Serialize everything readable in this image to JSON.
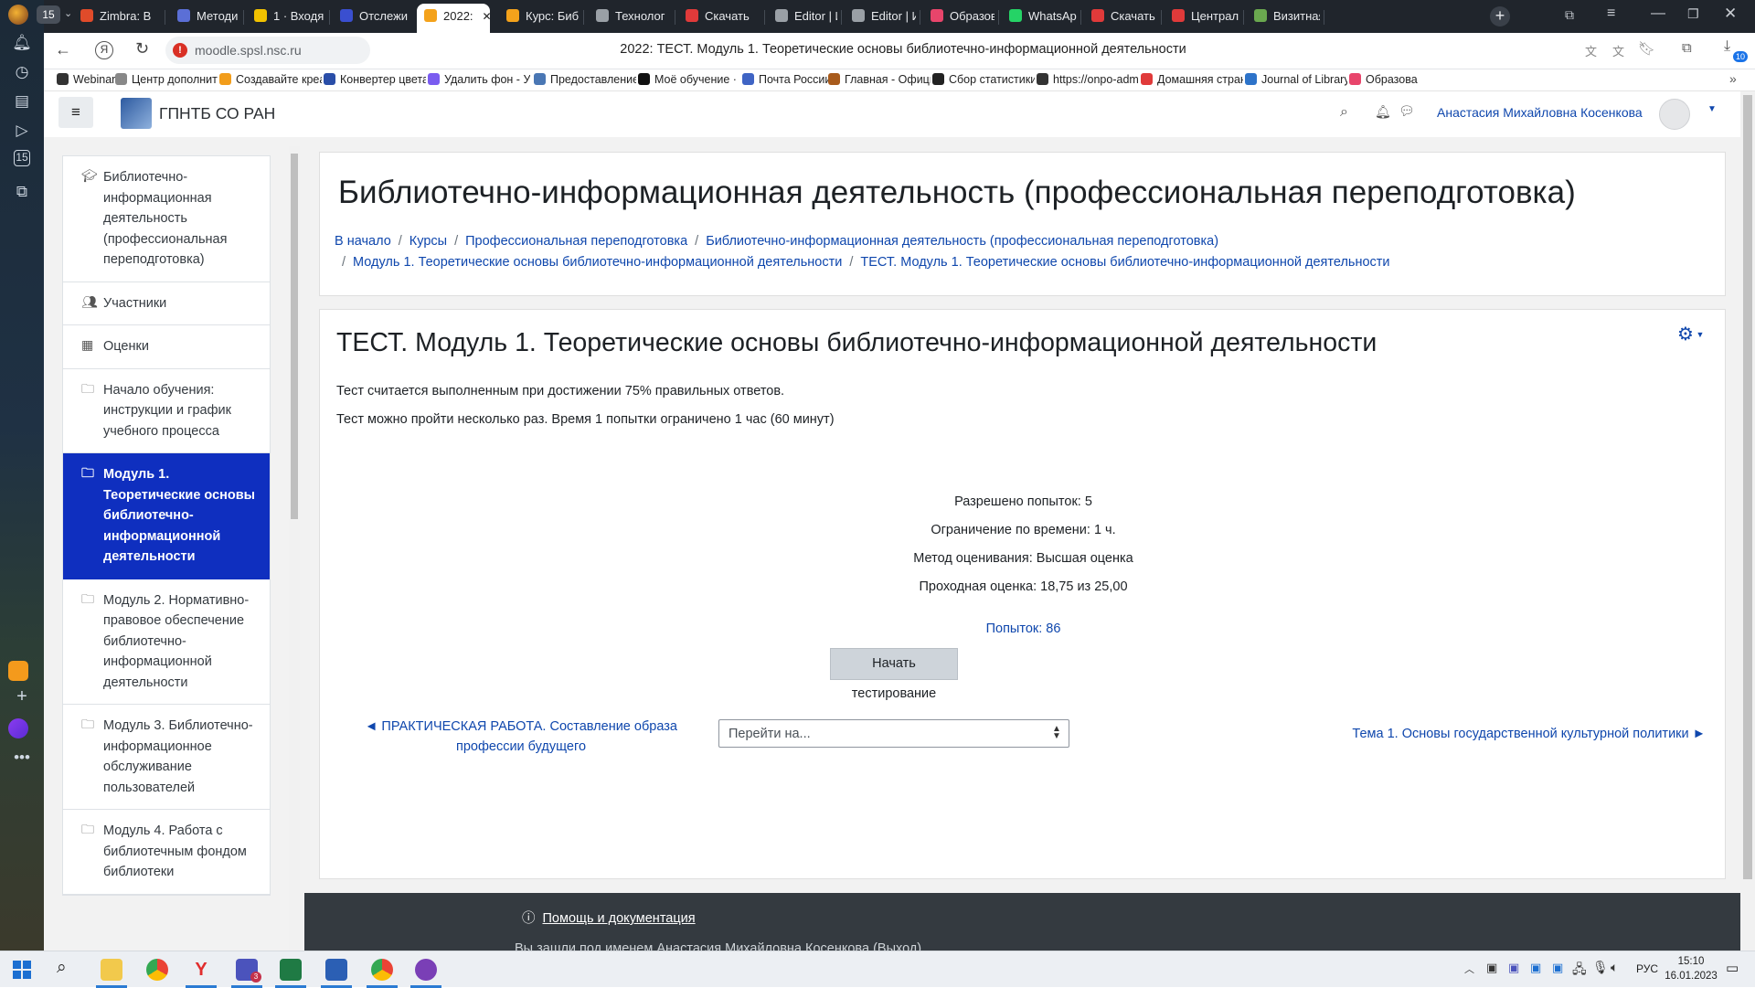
{
  "browser": {
    "tab_count": "15",
    "tabs": [
      {
        "label": "Zimbra: В",
        "color": "#e04b2a"
      },
      {
        "label": "Методи",
        "color": "#5b6fd6"
      },
      {
        "label": "1 · Входя",
        "color": "#f2c200"
      },
      {
        "label": "Отслежи",
        "color": "#3a4fd0"
      },
      {
        "label": "2022:",
        "color": "#f4a21b"
      },
      {
        "label": "Курс: Биб",
        "color": "#f4a21b"
      },
      {
        "label": "Технолог",
        "color": "#9aa0a6"
      },
      {
        "label": "Скачать",
        "color": "#e03a3a"
      },
      {
        "label": "Editor | И",
        "color": "#9aa0a6"
      },
      {
        "label": "Editor | И",
        "color": "#9aa0a6"
      },
      {
        "label": "Образов",
        "color": "#e8456b"
      },
      {
        "label": "WhatsAp",
        "color": "#25d366"
      },
      {
        "label": "Скачать",
        "color": "#e03a3a"
      },
      {
        "label": "Централ",
        "color": "#e03a3a"
      },
      {
        "label": "Визитная",
        "color": "#6aa84f"
      }
    ],
    "url": "moodle.spsl.nsc.ru",
    "page_title": "2022: ТЕСТ. Модуль 1. Теоретические основы библиотечно-информационной деятельности",
    "download_badge": "10",
    "bookmarks": [
      "Webinar",
      "Центр дополните",
      "Создавайте креат",
      "Конвертер цвета",
      "Удалить фон - Убр",
      "Предоставление с",
      "Моё обучение · М",
      "Почта России",
      "Главная - Официа",
      "Сбор статистики г",
      "https://onpo-adm",
      "Домашняя страни",
      "Journal of Library",
      "Образова"
    ]
  },
  "site": {
    "name": "ГПНТБ СО РАН",
    "user_name": "Анастасия Михайловна Косенкова"
  },
  "drawer": {
    "items": [
      {
        "icon": "graduation-cap-icon",
        "label": "Библиотечно-информационная деятельность (профессиональная переподготовка)",
        "active": false
      },
      {
        "icon": "users-icon",
        "label": "Участники",
        "active": false
      },
      {
        "icon": "table-icon",
        "label": "Оценки",
        "active": false
      },
      {
        "icon": "folder-icon",
        "label": "Начало обучения: инструкции и график учебного процесса",
        "active": false
      },
      {
        "icon": "folder-icon",
        "label": "Модуль 1. Теоретические основы библиотечно-информационной деятельности",
        "active": true
      },
      {
        "icon": "folder-icon",
        "label": "Модуль 2. Нормативно-правовое обеспечение библиотечно-информационной деятельности",
        "active": false
      },
      {
        "icon": "folder-icon",
        "label": "Модуль 3. Библиотечно-информационное обслуживание пользователей",
        "active": false
      },
      {
        "icon": "folder-icon",
        "label": "Модуль 4. Работа с библиотечным фондом библиотеки",
        "active": false
      }
    ]
  },
  "header": {
    "course_title": "Библиотечно-информационная деятельность (профессиональная переподготовка)",
    "breadcrumb": [
      "В начало",
      "Курсы",
      "Профессиональная переподготовка",
      "Библиотечно-информационная деятельность (профессиональная переподготовка)",
      "Модуль 1. Теоретические основы библиотечно-информационной деятельности",
      "ТЕСТ. Модуль 1. Теоретические основы библиотечно-информационной деятельности"
    ]
  },
  "quiz": {
    "title": "ТЕСТ. Модуль 1. Теоретические основы библиотечно-информационной деятельности",
    "intro_1": "Тест считается выполненным при достижении 75% правильных ответов.",
    "intro_2": "Тест можно пройти несколько раз. Время 1 попытки ограничено 1 час (60 минут)",
    "attempts_allowed": "Разрешено попыток: 5",
    "time_limit": "Ограничение по времени: 1 ч.",
    "grading_method": "Метод оценивания: Высшая оценка",
    "pass_grade": "Проходная оценка: 18,75 из 25,00",
    "attempts_link": "Попыток: 86",
    "start_button": "Начать тестирование",
    "prev_link": "◄ ПРАКТИЧЕСКАЯ РАБОТА. Составление образа профессии будущего",
    "jump_placeholder": "Перейти на...",
    "next_link": "Тема 1. Основы государственной культурной политики ►"
  },
  "footer": {
    "help_link": "Помощь и документация",
    "partial_text": "Вы зашли под именем Анастасия Михайловна Косенкова (Выход)"
  },
  "taskbar": {
    "lang": "РУС",
    "time": "15:10",
    "date": "16.01.2023",
    "teams_badge": "3"
  },
  "colors": {
    "accent": "#0f47ad",
    "active_item": "#0f2fbf",
    "button": "#ced4da",
    "footer": "#343a40"
  }
}
